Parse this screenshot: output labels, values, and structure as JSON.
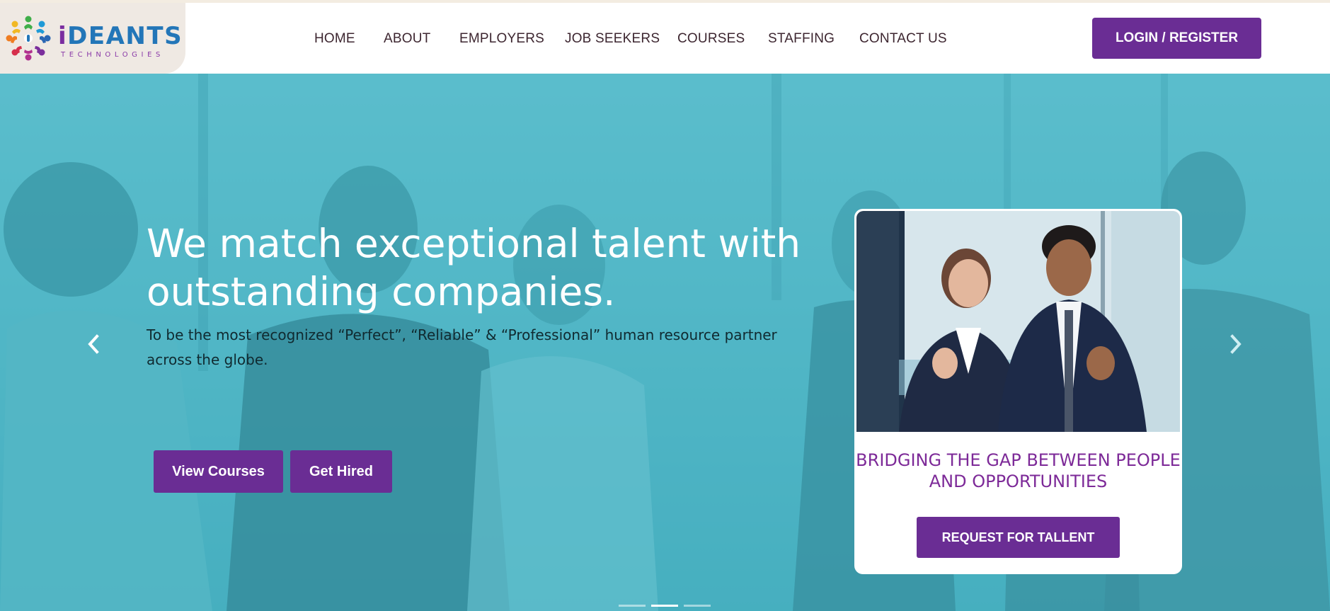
{
  "header": {
    "logo": {
      "brand_name": "iDEANTS",
      "brand_name_first": "i",
      "brand_name_rest": "DEANTS",
      "tagline": "TECHNOLOGIES"
    },
    "nav": [
      {
        "label": "HOME"
      },
      {
        "label": "ABOUT"
      },
      {
        "label": "EMPLOYERS"
      },
      {
        "label": "JOB SEEKERS"
      },
      {
        "label": "COURSES"
      },
      {
        "label": "STAFFING"
      },
      {
        "label": "CONTACT US"
      }
    ],
    "login_label": "LOGIN / REGISTER"
  },
  "hero": {
    "headline": "We match exceptional talent with outstanding companies.",
    "subtext": "To be the most recognized “Perfect”, “Reliable” & “Professional” human resource partner across the globe.",
    "buttons": {
      "view_courses": "View Courses",
      "get_hired": "Get Hired"
    },
    "carousel": {
      "prev_icon": "chevron-left-icon",
      "next_icon": "chevron-right-icon",
      "slide_count": 3,
      "active_index": 1
    }
  },
  "card": {
    "title": "BRIDGING THE GAP BETWEEN PEOPLE AND OPPORTUNITIES",
    "button_label": "REQUEST FOR TALLENT"
  },
  "colors": {
    "brand_purple": "#6a2d94",
    "hero_teal": "#4eb6c6",
    "card_title_purple": "#7d2a98",
    "logo_blue": "#2376b8"
  }
}
